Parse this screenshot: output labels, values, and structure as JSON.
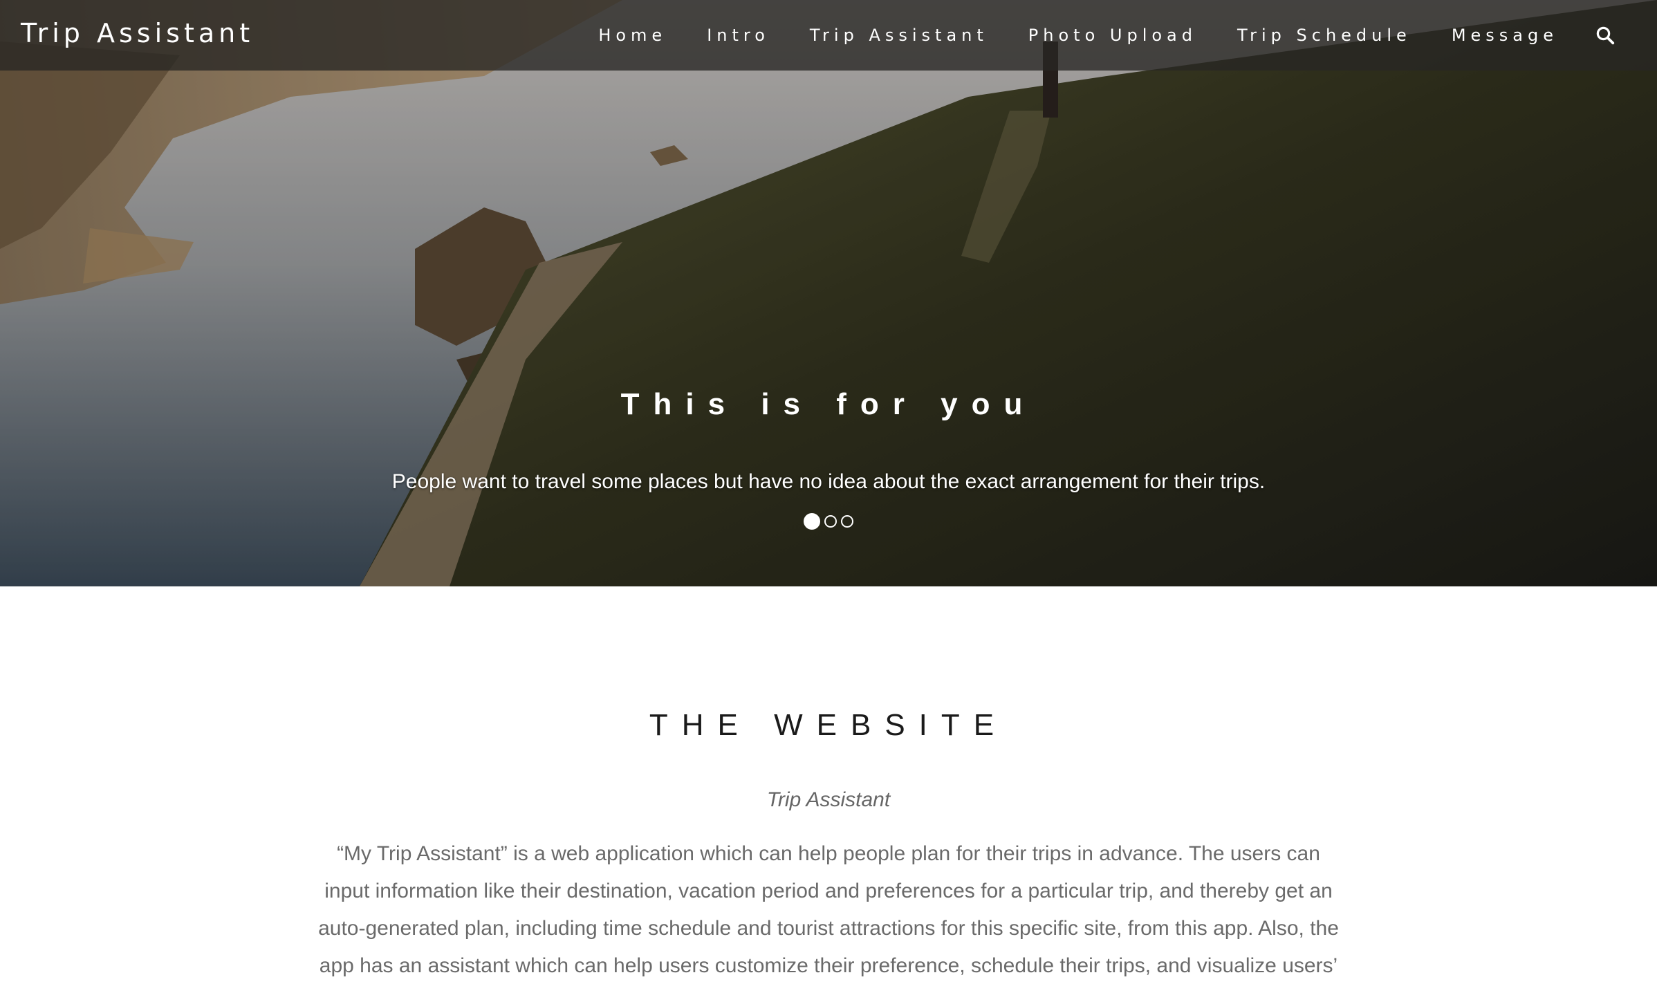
{
  "navbar": {
    "brand": "Trip Assistant",
    "items": [
      {
        "label": "Home"
      },
      {
        "label": "Intro"
      },
      {
        "label": "Trip Assistant"
      },
      {
        "label": "Photo Upload"
      },
      {
        "label": "Trip Schedule"
      },
      {
        "label": "Message"
      }
    ],
    "search_icon": "search-icon"
  },
  "hero": {
    "title": "This is for you",
    "caption": "People want to travel some places but have no idea about the exact arrangement for their trips.",
    "slides_total": 3,
    "active_slide": 1
  },
  "about": {
    "heading": "THE WEBSITE",
    "subheading": "Trip Assistant",
    "body": "“My Trip Assistant” is a web application which can help people plan for their trips in advance. The users can input information like their destination, vacation period and preferences for a particular trip, and thereby get an auto-generated plan, including time schedule and tourist attractions for this specific site, from this app. Also, the app has an assistant which can help users customize their preference, schedule their trips, and visualize users’"
  },
  "colors": {
    "nav_background": "#282624",
    "text_white": "#ffffff",
    "heading_dark": "#1a1a1a",
    "body_gray": "#6a6a6a"
  }
}
